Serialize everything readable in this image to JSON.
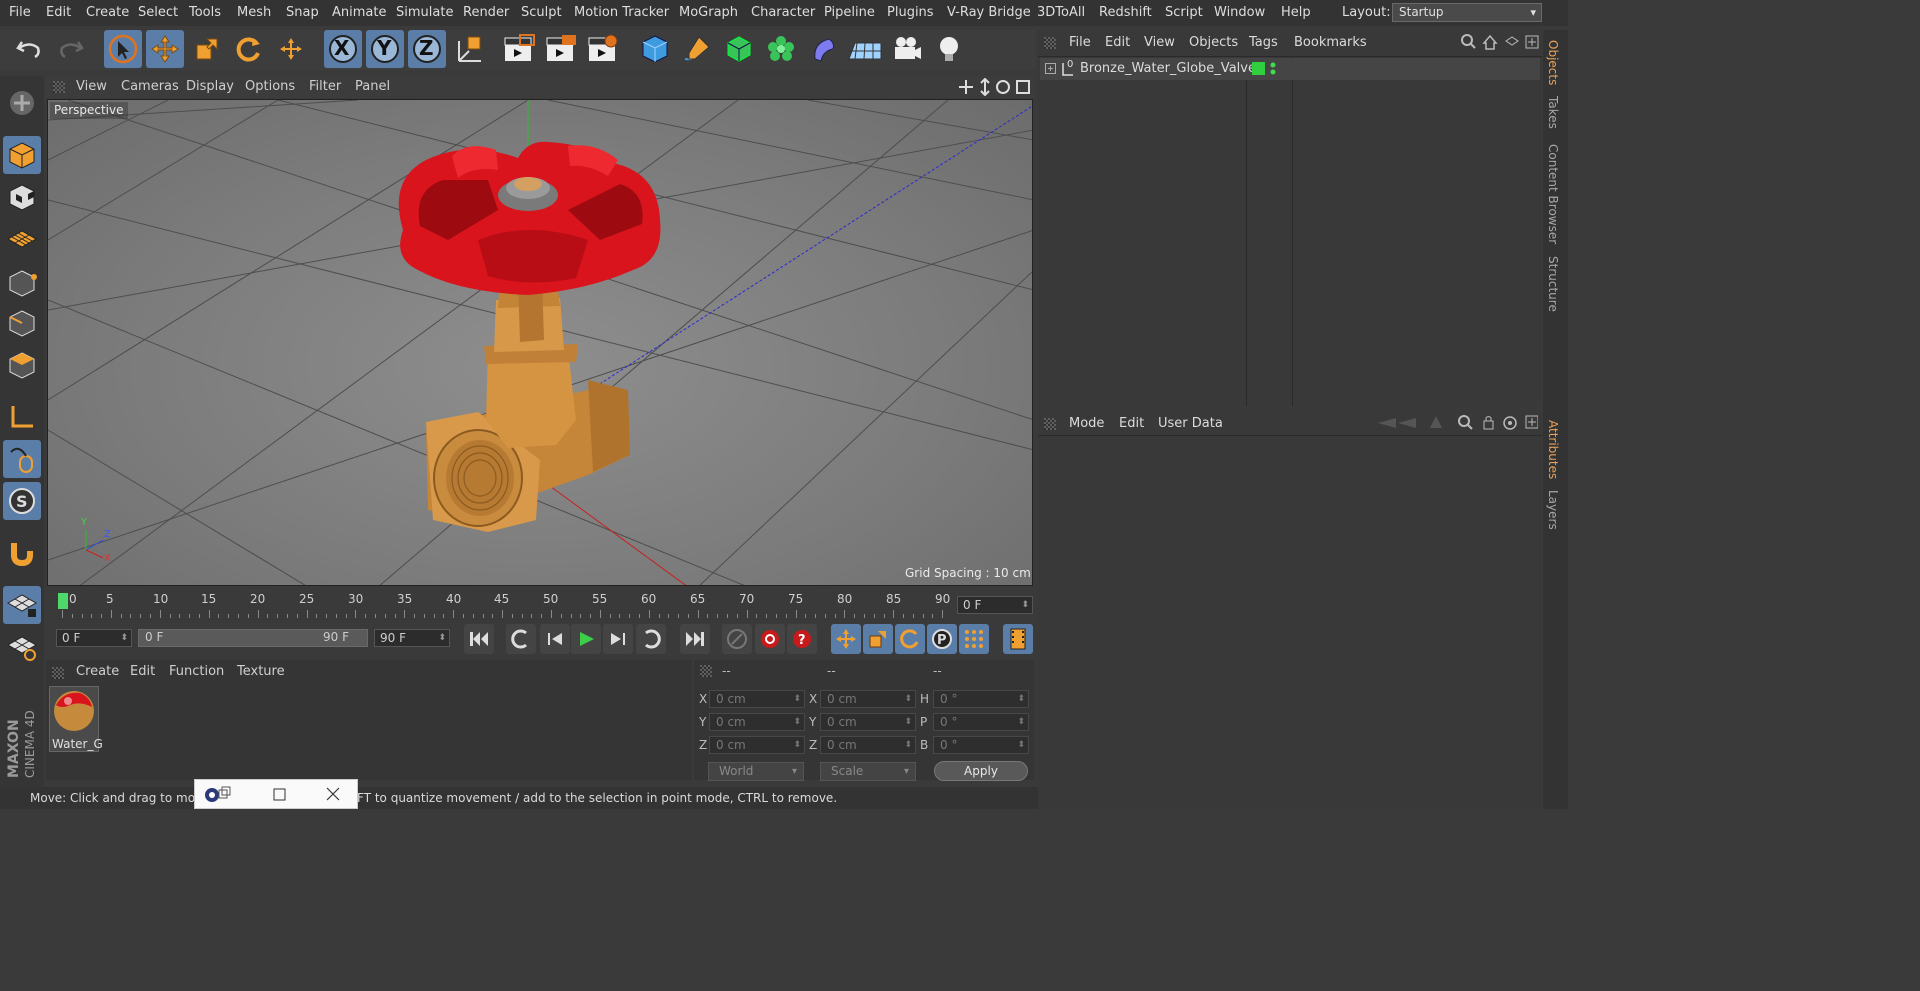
{
  "menubar": {
    "items": [
      "File",
      "Edit",
      "Create",
      "Select",
      "Tools",
      "Mesh",
      "Snap",
      "Animate",
      "Simulate",
      "Render",
      "Sculpt",
      "Motion Tracker",
      "MoGraph",
      "Character",
      "Pipeline",
      "Plugins",
      "V-Ray Bridge",
      "3DToAll",
      "Redshift",
      "Script",
      "Window",
      "Help"
    ],
    "layout_label": "Layout:",
    "layout_value": "Startup"
  },
  "toolbar": {
    "axis_x": "X",
    "axis_y": "Y",
    "axis_z": "Z"
  },
  "viewport": {
    "menu": [
      "View",
      "Cameras",
      "Display",
      "Options",
      "Filter",
      "Panel"
    ],
    "name": "Perspective",
    "grid_spacing": "Grid Spacing : 10 cm",
    "axis_x": "X",
    "axis_y": "Y",
    "axis_z": "Z"
  },
  "timeline": {
    "ticks": [
      "0",
      "5",
      "10",
      "15",
      "20",
      "25",
      "30",
      "35",
      "40",
      "45",
      "50",
      "55",
      "60",
      "65",
      "70",
      "75",
      "80",
      "85",
      "90"
    ],
    "current_frame": "0 F",
    "start_frame": "0 F",
    "range_start": "0 F",
    "range_end": "90 F",
    "end_frame": "90 F"
  },
  "material_manager": {
    "menu": [
      "Create",
      "Edit",
      "Function",
      "Texture"
    ],
    "material_name": "Water_G"
  },
  "coordinates": {
    "headers": [
      "--",
      "--",
      "--"
    ],
    "pos_labels": [
      "X",
      "Y",
      "Z"
    ],
    "size_labels": [
      "X",
      "Y",
      "Z"
    ],
    "rot_labels": [
      "H",
      "P",
      "B"
    ],
    "pos_values": [
      "0 cm",
      "0 cm",
      "0 cm"
    ],
    "size_values": [
      "0 cm",
      "0 cm",
      "0 cm"
    ],
    "rot_values": [
      "0 °",
      "0 °",
      "0 °"
    ],
    "space": "World",
    "mode": "Scale",
    "apply": "Apply"
  },
  "statusbar": {
    "text": "Move: Click and drag to mo",
    "text_tail": "FT to quantize movement / add to the selection in point mode, CTRL to remove."
  },
  "objects_panel": {
    "menu": [
      "File",
      "Edit",
      "View",
      "Objects",
      "Tags",
      "Bookmarks"
    ],
    "object_name": "Bronze_Water_Globe_Valve",
    "object_layer": "0"
  },
  "attributes_panel": {
    "menu": [
      "Mode",
      "Edit",
      "User Data"
    ]
  },
  "side_tabs": {
    "top": [
      "Objects",
      "Takes",
      "Content Browser",
      "Structure"
    ],
    "bottom": [
      "Attributes",
      "Layers"
    ]
  },
  "branding": {
    "logo_text": "MAXON CINEMA 4D"
  },
  "colors": {
    "accent_blue": "#5b7ea8",
    "accent_orange": "#e8a35a",
    "handle_red": "#d9141c",
    "body_bronze": "#d4963f",
    "layer_green": "#2fcf3f"
  }
}
